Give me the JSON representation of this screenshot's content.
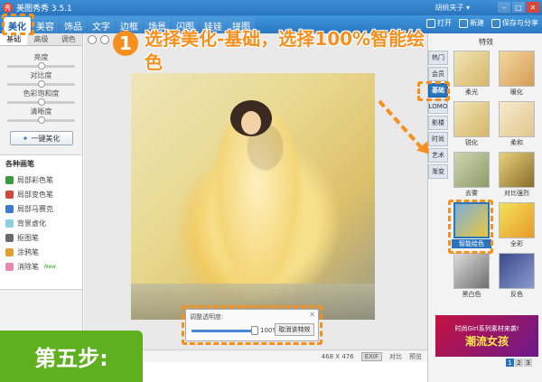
{
  "app": {
    "title": "美图秀秀 3.5.1",
    "user": "胡桃夹子 ▾"
  },
  "tabs": [
    "美化",
    "美容",
    "饰品",
    "文字",
    "边框",
    "场景",
    "闪图",
    "娃娃",
    "拼图"
  ],
  "toolbar": {
    "open": "打开",
    "new": "新建",
    "save_share": "保存与分享"
  },
  "left": {
    "subtabs": [
      "基础",
      "高级",
      "调色"
    ],
    "sliders": [
      {
        "label": "亮度",
        "value": 0.5
      },
      {
        "label": "对比度",
        "value": 0.5
      },
      {
        "label": "色彩饱和度",
        "value": 0.5
      },
      {
        "label": "清晰度",
        "value": 0.5
      }
    ],
    "onekey": "一键美化",
    "brushes_title": "各种画笔",
    "brushes": [
      {
        "label": "局部彩色笔",
        "color": "#3a9c3a",
        "new": false
      },
      {
        "label": "局部变色笔",
        "color": "#d04a3a",
        "new": false
      },
      {
        "label": "局部马赛克",
        "color": "#3a7cd0",
        "new": false
      },
      {
        "label": "背景虚化",
        "color": "#8ad0e0",
        "new": false
      },
      {
        "label": "抠图笔",
        "color": "#6a6a6a",
        "new": false
      },
      {
        "label": "涂鸦笔",
        "color": "#e0a030",
        "new": false
      },
      {
        "label": "消除笔",
        "color": "#e88ab0",
        "new": true
      }
    ],
    "new_badge": "New"
  },
  "canvas": {
    "opacity_label": "调整透明度:",
    "opacity_value": "100%",
    "opacity_fraction": 1.0,
    "cancel_effect": "取消该特效"
  },
  "status": {
    "width": "468",
    "sep": "X",
    "height": "476",
    "compare": "对比",
    "preview": "预览"
  },
  "right": {
    "header": "特效",
    "categories": [
      "热门",
      "会员",
      "基础",
      "LOMO",
      "影楼",
      "时尚",
      "艺术",
      "渐变"
    ],
    "active_category": "基础",
    "effects": [
      "柔光",
      "暖化",
      "锐化",
      "柔和",
      "去雾",
      "对比强烈",
      "智能绘色",
      "全彩",
      "黑白色",
      "反色"
    ],
    "selected_effect": "智能绘色",
    "ad_line1": "时尚Girl系列素材来袭!",
    "ad_line2": "潮流女孩",
    "pages": [
      "1",
      "2",
      "3"
    ],
    "current_page": "1"
  },
  "annotation": {
    "step_number": "1",
    "text": "选择美化-基础，选择100%智能绘色",
    "badge": "第五步:"
  },
  "colors": {
    "accent": "#f5901e",
    "blue": "#2a74bd",
    "green": "#5fb01f"
  }
}
